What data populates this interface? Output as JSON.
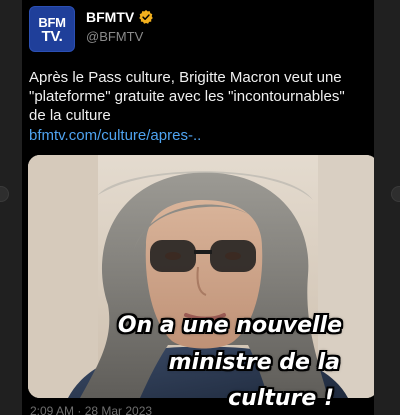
{
  "account": {
    "logo_line1": "BFM",
    "logo_line2": "TV.",
    "name": "BFMTV",
    "handle": "@BFMTV",
    "verified_icon": "verified-badge-icon",
    "verified_color": "#f2b01e",
    "logo_color": "#1f3f9a"
  },
  "tweet": {
    "lines": [
      "Après le Pass culture, Brigitte Macron veut une",
      "\"plateforme\" gratuite avec les \"incontournables\"",
      "de la culture"
    ],
    "link": "bfmtv.com/culture/apres-..",
    "link_color": "#4fa3f0"
  },
  "media": {
    "caption_lines": [
      "On a une nouvelle",
      "ministre de la",
      "culture !"
    ]
  },
  "footer": {
    "timestamp": "2:09 AM · 28 Mar 2023"
  }
}
